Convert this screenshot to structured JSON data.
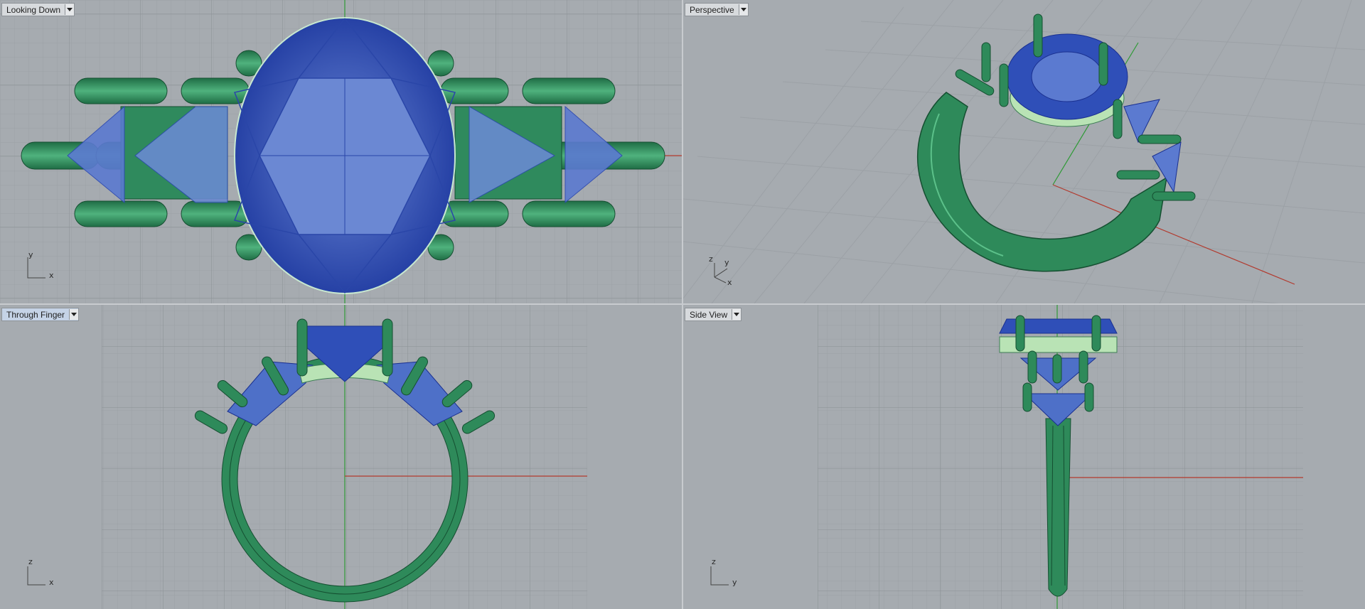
{
  "colors": {
    "viewport_bg": "#a6abb0",
    "grid_minor": "#9ca1a6",
    "grid_major": "#8b9095",
    "axis_x": "#b23a2e",
    "axis_y": "#2f9a36",
    "metal": "#2e8a5a",
    "metal_highlight": "#b9e3b5",
    "gem": "#2f4fb8",
    "gem_light": "#5b7ad0"
  },
  "viewports": [
    {
      "title": "Looking Down",
      "active": false,
      "axes": [
        "y",
        "x"
      ]
    },
    {
      "title": "Perspective",
      "active": false,
      "axes": [
        "z",
        "y",
        "x"
      ]
    },
    {
      "title": "Through Finger",
      "active": true,
      "axes": [
        "z",
        "x"
      ]
    },
    {
      "title": "Side View",
      "active": false,
      "axes": [
        "z",
        "y"
      ]
    }
  ]
}
